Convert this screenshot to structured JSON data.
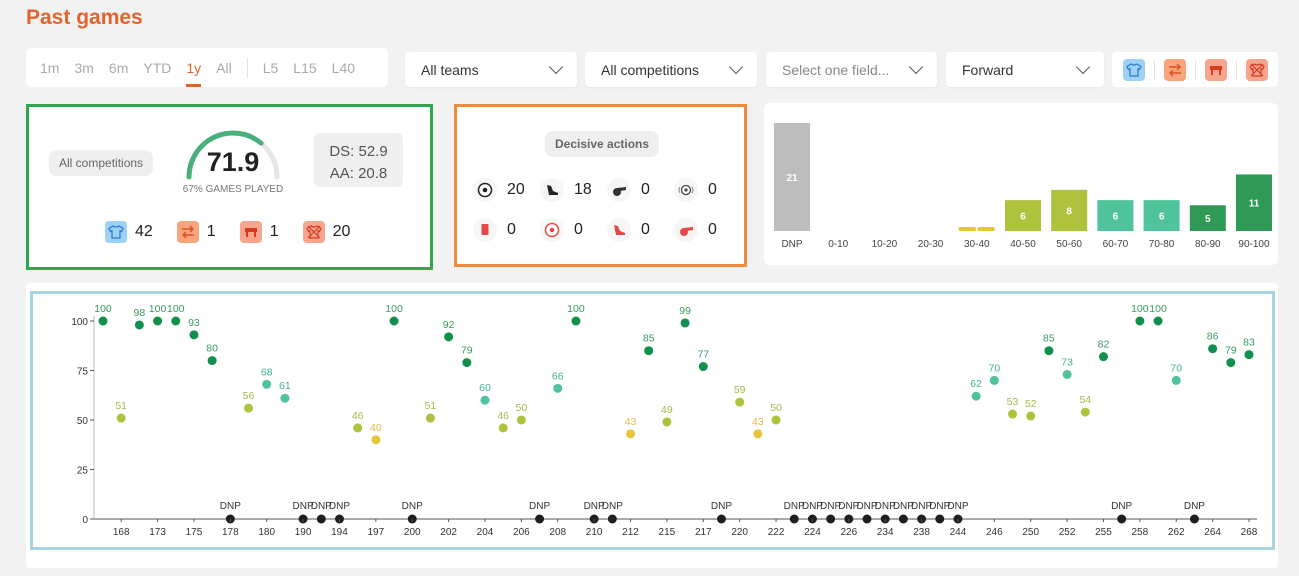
{
  "header": {
    "title": "Past games"
  },
  "period_tabs": {
    "items": [
      "1m",
      "3m",
      "6m",
      "YTD",
      "1y",
      "All"
    ],
    "items2": [
      "L5",
      "L15",
      "L40"
    ],
    "active": "1y"
  },
  "filters": {
    "teams": "All teams",
    "competitions": "All competitions",
    "field_placeholder": "Select one field...",
    "position": "Forward"
  },
  "status_icons": [
    "shirt-icon",
    "substitution-icon",
    "bench-icon",
    "not-in-squad-icon"
  ],
  "summary": {
    "competition_label": "All competitions",
    "score": "71.9",
    "score_fraction": 0.719,
    "games_played": "67% GAMES PLAYED",
    "ds": "DS: 52.9",
    "aa": "AA: 20.8",
    "counts": [
      {
        "icon": "shirt-icon",
        "value": "42"
      },
      {
        "icon": "substitution-icon",
        "value": "1"
      },
      {
        "icon": "bench-icon",
        "value": "1"
      },
      {
        "icon": "not-in-squad-icon",
        "value": "20"
      }
    ]
  },
  "decisive": {
    "label": "Decisive actions",
    "items": [
      {
        "icon": "goal-icon",
        "value": "20"
      },
      {
        "icon": "assist-boot-icon",
        "value": "18"
      },
      {
        "icon": "penalty-won-whistle-icon",
        "value": "0"
      },
      {
        "icon": "clean-sheet-icon",
        "value": "0"
      },
      {
        "icon": "red-card-icon",
        "value": "0"
      },
      {
        "icon": "own-goal-icon",
        "value": "0"
      },
      {
        "icon": "error-boot-icon",
        "value": "0"
      },
      {
        "icon": "penalty-conceded-whistle-icon",
        "value": "0"
      }
    ]
  },
  "colors": {
    "accent": "#e0652d",
    "dnp": "#bdbdbd",
    "yellow": "#e8c43a",
    "olive": "#afc23e",
    "teal": "#4fc39a",
    "green": "#2f9a55",
    "darkgreen": "#118f4d",
    "black": "#1e1e1e"
  },
  "chart_data": [
    {
      "type": "bar",
      "categories": [
        "DNP",
        "0-10",
        "10-20",
        "20-30",
        "30-40",
        "40-50",
        "50-60",
        "60-70",
        "70-80",
        "80-90",
        "90-100"
      ],
      "values": [
        21,
        0,
        0,
        0,
        0,
        6,
        8,
        6,
        6,
        5,
        11
      ]
    },
    {
      "type": "scatter",
      "ylim": [
        0,
        100
      ],
      "yticks": [
        0,
        25,
        50,
        75,
        100
      ],
      "xticklabels": [
        "168",
        "173",
        "175",
        "178",
        "180",
        "190",
        "194",
        "197",
        "200",
        "202",
        "204",
        "206",
        "208",
        "210",
        "212",
        "215",
        "217",
        "220",
        "222",
        "224",
        "226",
        "234",
        "238",
        "244",
        "246",
        "250",
        "252",
        "255",
        "258",
        "262",
        "264",
        "268"
      ],
      "dnp_label": "DNP",
      "values": [
        100,
        51,
        98,
        100,
        100,
        93,
        80,
        "DNP",
        56,
        68,
        61,
        "DNP",
        "DNP",
        "DNP",
        46,
        40,
        100,
        "DNP",
        51,
        92,
        79,
        60,
        46,
        50,
        "DNP",
        66,
        100,
        "DNP",
        "DNP",
        43,
        85,
        49,
        99,
        77,
        "DNP",
        59,
        43,
        50,
        "DNP",
        "DNP",
        "DNP",
        "DNP",
        "DNP",
        "DNP",
        "DNP",
        "DNP",
        "DNP",
        "DNP",
        62,
        70,
        53,
        52,
        85,
        73,
        54,
        82,
        "DNP",
        100,
        100,
        70,
        "DNP",
        86,
        79,
        83
      ]
    }
  ]
}
